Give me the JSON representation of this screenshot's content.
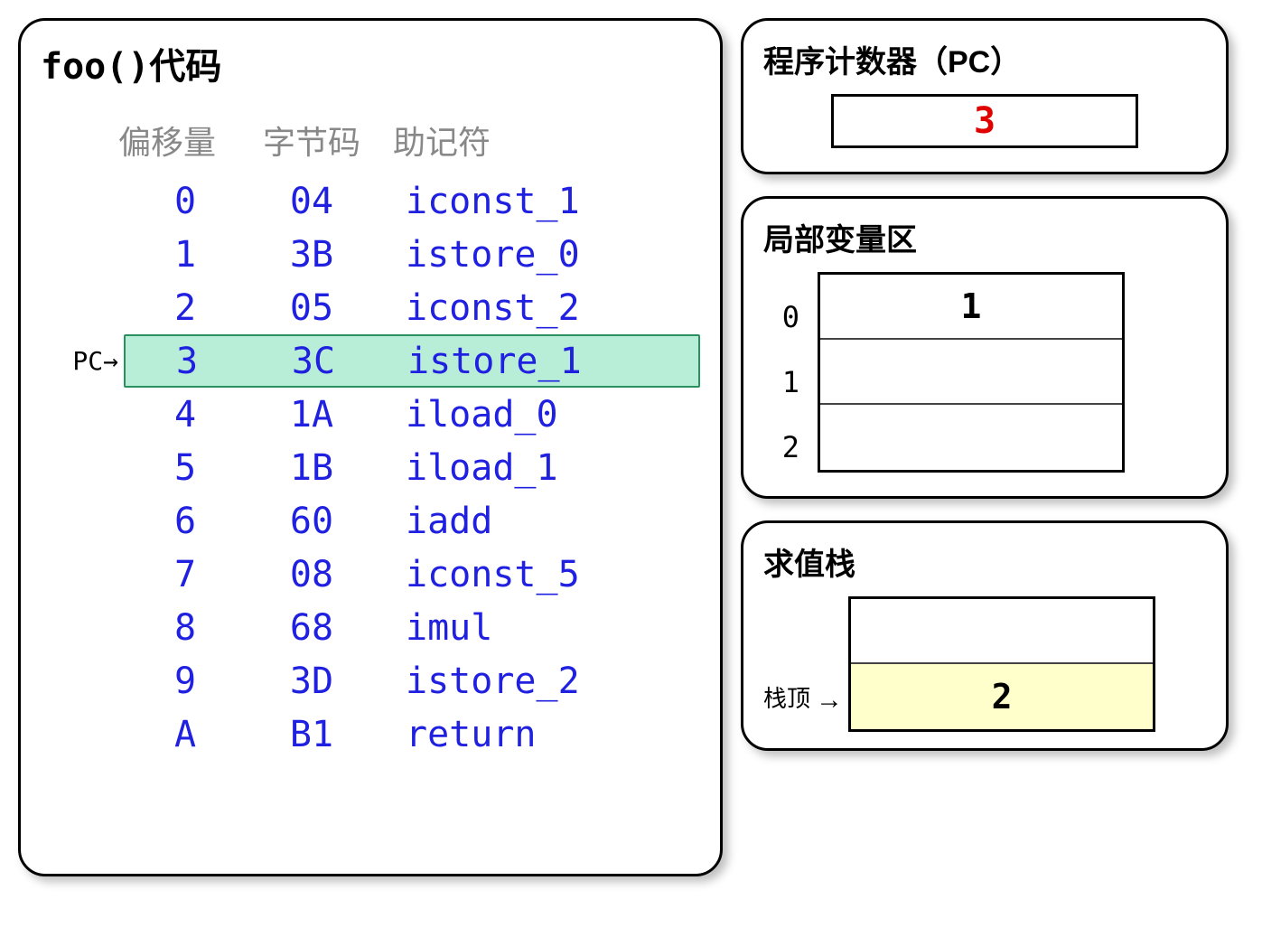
{
  "code_panel": {
    "title_mono": "foo()",
    "title_cn": "代码",
    "headers": {
      "offset": "偏移量",
      "bytecode": "字节码",
      "mnemonic": "助记符"
    },
    "pc_pointer_text": "PC→",
    "highlighted_offset": "3",
    "rows": [
      {
        "offset": "0",
        "bytecode": "04",
        "mnemonic": "iconst_1"
      },
      {
        "offset": "1",
        "bytecode": "3B",
        "mnemonic": "istore_0"
      },
      {
        "offset": "2",
        "bytecode": "05",
        "mnemonic": "iconst_2"
      },
      {
        "offset": "3",
        "bytecode": "3C",
        "mnemonic": "istore_1"
      },
      {
        "offset": "4",
        "bytecode": "1A",
        "mnemonic": "iload_0"
      },
      {
        "offset": "5",
        "bytecode": "1B",
        "mnemonic": "iload_1"
      },
      {
        "offset": "6",
        "bytecode": "60",
        "mnemonic": "iadd"
      },
      {
        "offset": "7",
        "bytecode": "08",
        "mnemonic": "iconst_5"
      },
      {
        "offset": "8",
        "bytecode": "68",
        "mnemonic": "imul"
      },
      {
        "offset": "9",
        "bytecode": "3D",
        "mnemonic": "istore_2"
      },
      {
        "offset": "A",
        "bytecode": "B1",
        "mnemonic": "return"
      }
    ]
  },
  "pc_panel": {
    "title": "程序计数器（PC）",
    "value": "3"
  },
  "locals_panel": {
    "title": "局部变量区",
    "slots": [
      {
        "index": "0",
        "value": "1"
      },
      {
        "index": "1",
        "value": ""
      },
      {
        "index": "2",
        "value": ""
      }
    ]
  },
  "stack_panel": {
    "title": "求值栈",
    "top_label": "栈顶",
    "arrow": "→",
    "slots": [
      {
        "value": "",
        "is_top": false
      },
      {
        "value": "2",
        "is_top": true
      }
    ]
  }
}
